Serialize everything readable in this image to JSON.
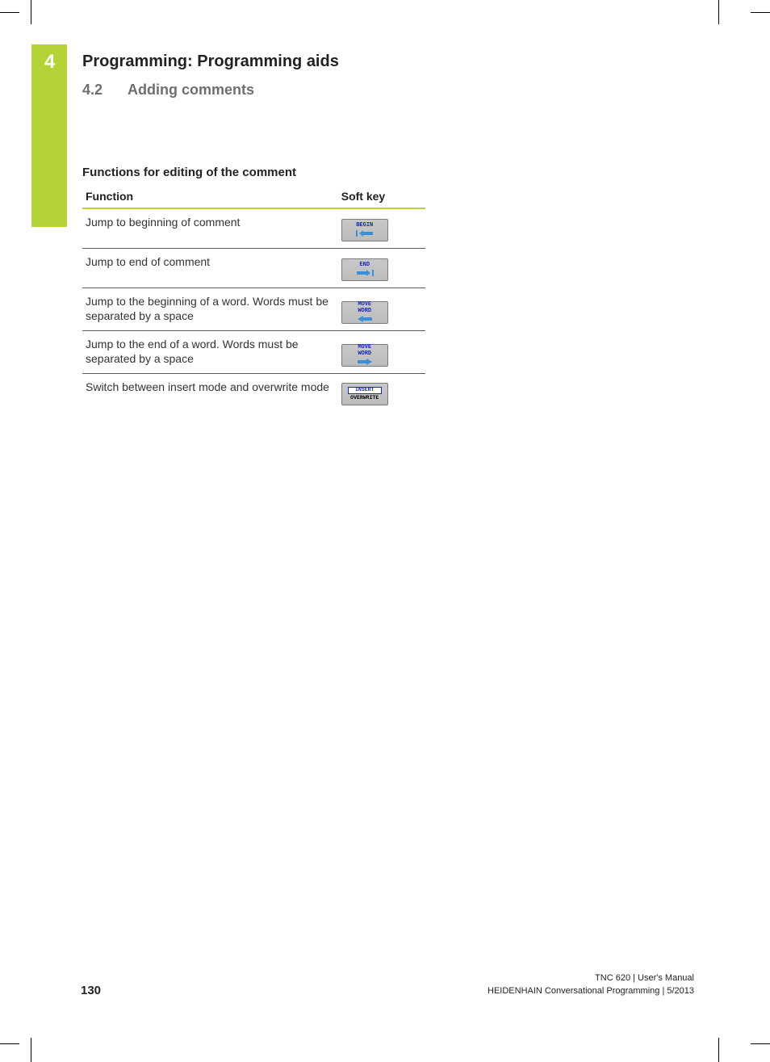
{
  "chapter": {
    "number": "4",
    "title": "Programming: Programming aids"
  },
  "section": {
    "number": "4.2",
    "title": "Adding comments"
  },
  "subheading": "Functions for editing of the comment",
  "table": {
    "headers": {
      "function": "Function",
      "softkey": "Soft key"
    },
    "rows": [
      {
        "function": "Jump to beginning of comment",
        "softkey": {
          "label1": "BEGIN",
          "label2": "",
          "icon": "arrow-left-bar"
        }
      },
      {
        "function": "Jump to end of comment",
        "softkey": {
          "label1": "END",
          "label2": "",
          "icon": "arrow-right-bar"
        }
      },
      {
        "function": "Jump to the beginning of a word. Words must be separated by a space",
        "softkey": {
          "label1": "MOVE",
          "label2": "WORD",
          "icon": "arrow-left"
        }
      },
      {
        "function": "Jump to the end of a word. Words must be separated by a space",
        "softkey": {
          "label1": "MOVE",
          "label2": "WORD",
          "icon": "arrow-right"
        }
      },
      {
        "function": "Switch between insert mode and overwrite mode",
        "softkey": {
          "label1": "INSERT",
          "label2": "OVERWRITE",
          "icon": "insert-overwrite"
        }
      }
    ]
  },
  "footer": {
    "page": "130",
    "line1": "TNC 620 | User's Manual",
    "line2": "HEIDENHAIN Conversational Programming | 5/2013"
  }
}
